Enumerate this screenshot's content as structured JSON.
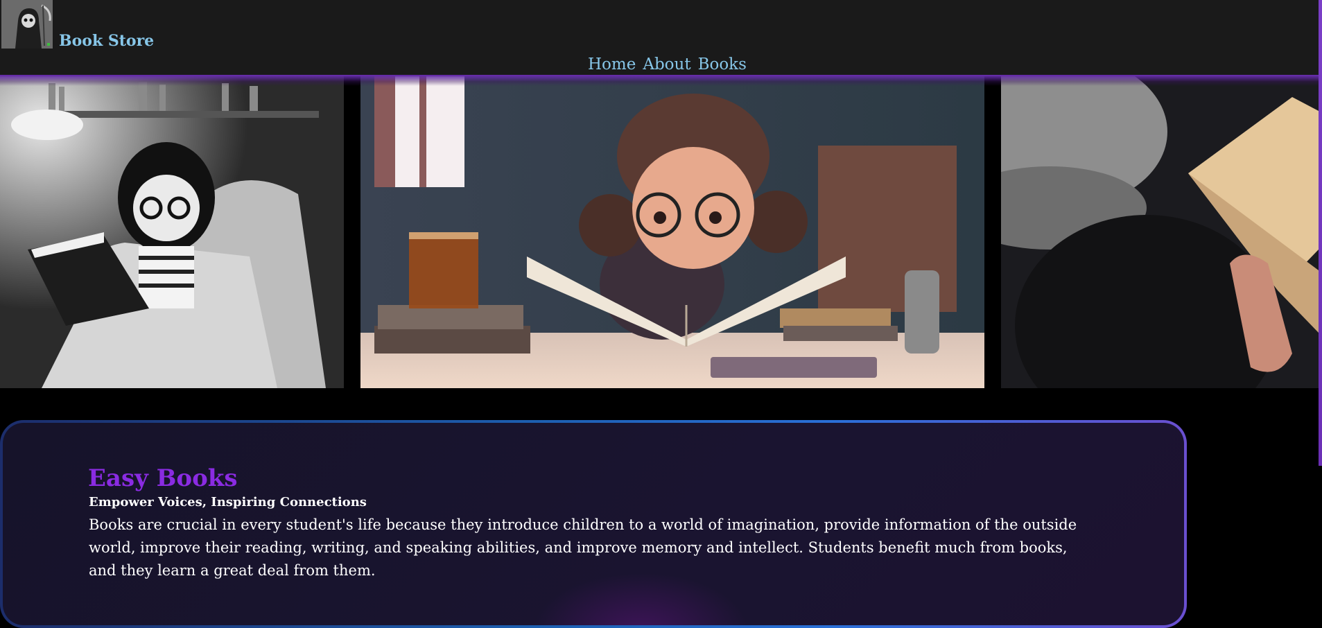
{
  "header": {
    "brand": "Book Store",
    "logo_icon": "grim-reaper-logo-icon",
    "nav": [
      {
        "label": "Home"
      },
      {
        "label": "About"
      },
      {
        "label": "Books"
      }
    ]
  },
  "carousel": {
    "slides": [
      {
        "name": "girl-reading-armchair-grayscale"
      },
      {
        "name": "girl-reading-at-desk"
      },
      {
        "name": "hands-holding-open-book"
      }
    ]
  },
  "intro": {
    "title": "Easy Books",
    "subtitle": "Empower Voices, Inspiring Connections",
    "body": "Books are crucial in every student's life because they introduce children to a world of imagination, provide information of the outside world, improve their reading, writing, and speaking abilities, and improve memory and intellect. Students benefit much from books, and they learn a great deal from them."
  },
  "colors": {
    "header_bg": "#1a1a1a",
    "nav_link": "#87c6e8",
    "accent_purple": "#8a2be2",
    "card_border_blue": "#2a6fd6",
    "page_bg": "#000000"
  }
}
